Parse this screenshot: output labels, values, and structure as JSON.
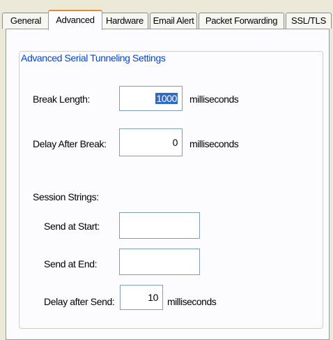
{
  "tabs": [
    {
      "label": "General",
      "active": false
    },
    {
      "label": "Advanced",
      "active": true
    },
    {
      "label": "Hardware",
      "active": false
    },
    {
      "label": "Email Alert",
      "active": false
    },
    {
      "label": "Packet Forwarding",
      "active": false
    },
    {
      "label": "SSL/TLS",
      "active": false
    }
  ],
  "group": {
    "title": "Advanced Serial Tunneling Settings",
    "break_length": {
      "label": "Break Length:",
      "value": "1000",
      "unit": "milliseconds"
    },
    "delay_after_break": {
      "label": "Delay After Break:",
      "value": "0",
      "unit": "milliseconds"
    },
    "session_strings": {
      "heading": "Session Strings:",
      "send_at_start": {
        "label": "Send at Start:",
        "value": ""
      },
      "send_at_end": {
        "label": "Send at End:",
        "value": ""
      },
      "delay_after_send": {
        "label": "Delay after Send:",
        "value": "10",
        "unit": "milliseconds"
      }
    }
  },
  "colors": {
    "accent_tab": "#e68b2c",
    "group_title": "#0046d5",
    "selection": "#316ac5"
  }
}
